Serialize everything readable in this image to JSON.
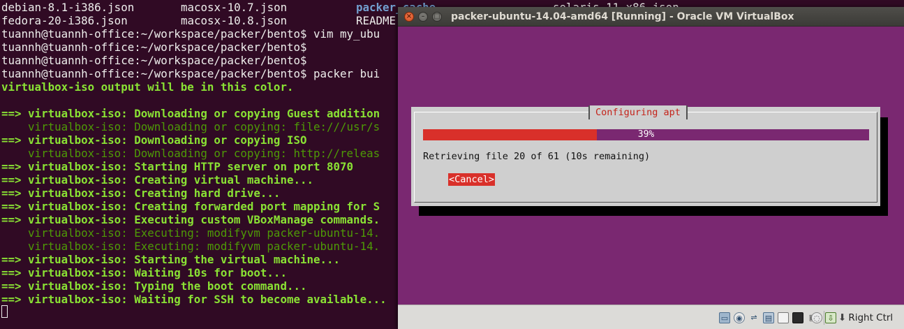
{
  "terminal": {
    "files_row1": [
      "debian-8.1-i386.json",
      "macosx-10.7.json",
      "packer_cache",
      "solaris-11-x86.json"
    ],
    "files_row2": [
      "fedora-20-i386.json",
      "macosx-10.8.json",
      "README"
    ],
    "lines": [
      {
        "text": "tuannh@tuannh-office:~/workspace/packer/bento$ vim my_ubu",
        "style": "white"
      },
      {
        "text": "tuannh@tuannh-office:~/workspace/packer/bento$",
        "style": "white"
      },
      {
        "text": "tuannh@tuannh-office:~/workspace/packer/bento$",
        "style": "white"
      },
      {
        "text": "tuannh@tuannh-office:~/workspace/packer/bento$ packer bui",
        "style": "white"
      },
      {
        "text": "virtualbox-iso output will be in this color.",
        "style": "bgreen"
      },
      {
        "text": "",
        "style": "white"
      },
      {
        "text": "==> virtualbox-iso: Downloading or copying Guest addition",
        "style": "bgreen"
      },
      {
        "text": "    virtualbox-iso: Downloading or copying: file:///usr/s",
        "style": "green"
      },
      {
        "text": "==> virtualbox-iso: Downloading or copying ISO",
        "style": "bgreen"
      },
      {
        "text": "    virtualbox-iso: Downloading or copying: http://releas",
        "style": "green"
      },
      {
        "text": "==> virtualbox-iso: Starting HTTP server on port 8070",
        "style": "bgreen"
      },
      {
        "text": "==> virtualbox-iso: Creating virtual machine...",
        "style": "bgreen"
      },
      {
        "text": "==> virtualbox-iso: Creating hard drive...",
        "style": "bgreen"
      },
      {
        "text": "==> virtualbox-iso: Creating forwarded port mapping for S",
        "style": "bgreen"
      },
      {
        "text": "==> virtualbox-iso: Executing custom VBoxManage commands.",
        "style": "bgreen"
      },
      {
        "text": "    virtualbox-iso: Executing: modifyvm packer-ubuntu-14.",
        "style": "green"
      },
      {
        "text": "    virtualbox-iso: Executing: modifyvm packer-ubuntu-14.",
        "style": "green"
      },
      {
        "text": "==> virtualbox-iso: Starting the virtual machine...",
        "style": "bgreen"
      },
      {
        "text": "==> virtualbox-iso: Waiting 10s for boot...",
        "style": "bgreen"
      },
      {
        "text": "==> virtualbox-iso: Typing the boot command...",
        "style": "bgreen"
      },
      {
        "text": "==> virtualbox-iso: Waiting for SSH to become available...",
        "style": "bgreen"
      }
    ]
  },
  "vbox": {
    "window_title": "packer-ubuntu-14.04-amd64 [Running] - Oracle VM VirtualBox",
    "titlebar_buttons": {
      "close": "×",
      "minimize": "–",
      "maximize": "□"
    },
    "dialog": {
      "title": "Configuring apt",
      "progress_percent": 39,
      "progress_label": "39%",
      "status_text": "Retrieving file 20 of 61 (10s remaining)",
      "cancel_label": "<Cancel>"
    },
    "status_bar": {
      "icons": [
        "hard-disk-icon",
        "optical-disk-icon",
        "usb-icon",
        "network-icon",
        "shared-folder-icon",
        "display-icon",
        "video-capture-icon",
        "mouse-integration-icon",
        "keyboard-capture-icon",
        "host-key-arrow-icon"
      ],
      "host_key": "Right Ctrl"
    }
  },
  "colors": {
    "terminal_bg": "#300a24",
    "guest_bg": "#7a2871",
    "progress_fill": "#d9302a",
    "dialog_bg": "#cfcfcf"
  }
}
